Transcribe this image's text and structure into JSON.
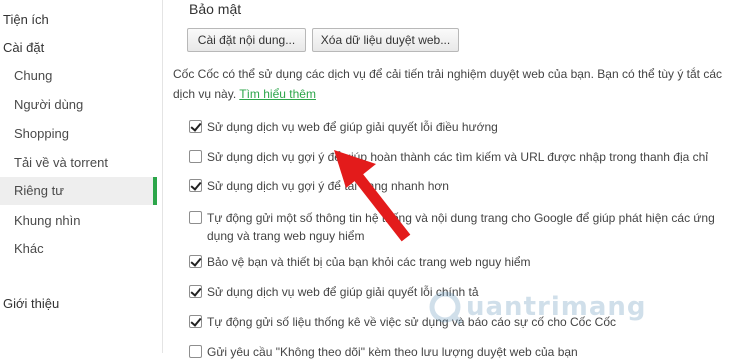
{
  "sidebar": {
    "headings": [
      {
        "label": "Tiện ích"
      },
      {
        "label": "Cài đặt"
      },
      {
        "label": "Giới thiệu"
      }
    ],
    "items": [
      {
        "label": "Chung"
      },
      {
        "label": "Người dùng"
      },
      {
        "label": "Shopping"
      },
      {
        "label": "Tải về và torrent"
      },
      {
        "label": "Riêng tư",
        "active": true
      },
      {
        "label": "Khung nhìn"
      },
      {
        "label": "Khác"
      }
    ]
  },
  "main": {
    "section_title": "Bảo mật",
    "buttons": {
      "content_settings": "Cài đặt nội dung...",
      "clear_data": "Xóa dữ liệu duyệt web..."
    },
    "description": {
      "line1": "Cốc Cốc có thể sử dụng các dịch vụ để cải tiến trải nghiệm duyệt web của bạn. Bạn có thể tùy ý tắt các",
      "line2_prefix": "dịch vụ này. ",
      "learn_more": "Tìm hiểu thêm"
    },
    "options": [
      {
        "label": "Sử dụng dịch vụ web để giúp giải quyết lỗi điều hướng",
        "checked": true
      },
      {
        "label": "Sử dụng dịch vụ gợi ý để giúp hoàn thành các tìm kiếm và URL được nhập trong thanh địa chỉ",
        "checked": false
      },
      {
        "label": "Sử dụng dịch vụ gợi ý để tải trang nhanh hơn",
        "checked": true
      },
      {
        "label": "Tự động gửi một số thông tin hệ thống và nội dung trang cho Google để giúp phát hiện các ứng dụng và trang web nguy hiểm",
        "checked": false
      },
      {
        "label": "Bảo vệ bạn và thiết bị của bạn khỏi các trang web nguy hiểm",
        "checked": true
      },
      {
        "label": "Sử dụng dịch vụ web để giúp giải quyết lỗi chính tả",
        "checked": true
      },
      {
        "label": "Tự động gửi số liệu thống kê về việc sử dụng và báo cáo sự cố cho Cốc Cốc",
        "checked": true
      },
      {
        "label": "Gửi yêu cầu \"Không theo dõi\" kèm theo lưu lượng duyệt web của bạn",
        "checked": false
      }
    ]
  },
  "watermark": {
    "text": "uantrimang",
    "icon": "logo-q-icon"
  },
  "annotation": {
    "icon": "red-arrow-icon",
    "color": "#e31b1b"
  },
  "colors": {
    "accent": "#2ca64a",
    "active_bg": "#eeeeee"
  }
}
